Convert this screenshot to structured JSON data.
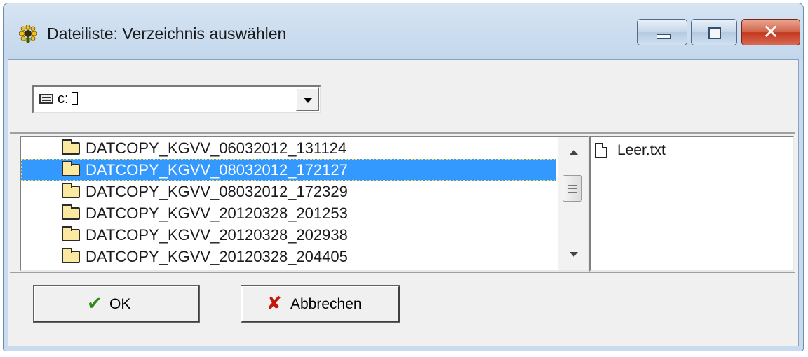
{
  "window": {
    "title": "Dateiliste: Verzeichnis auswählen",
    "icon": "sunflower-app-icon",
    "controls": {
      "minimize": "minimize-icon",
      "maximize": "maximize-icon",
      "close": "close-icon"
    }
  },
  "drive_select": {
    "value": "c:",
    "icon": "drive-icon"
  },
  "directories": [
    {
      "name": "DATCOPY_KGVV_06032012_131124",
      "selected": false
    },
    {
      "name": "DATCOPY_KGVV_08032012_172127",
      "selected": true
    },
    {
      "name": "DATCOPY_KGVV_08032012_172329",
      "selected": false
    },
    {
      "name": "DATCOPY_KGVV_20120328_201253",
      "selected": false
    },
    {
      "name": "DATCOPY_KGVV_20120328_202938",
      "selected": false
    },
    {
      "name": "DATCOPY_KGVV_20120328_204405",
      "selected": false
    }
  ],
  "files": [
    {
      "name": "Leer.txt"
    }
  ],
  "buttons": {
    "ok_label": "OK",
    "cancel_label": "Abbrechen"
  },
  "colors": {
    "selection": "#3399ff",
    "ok_icon": "#2f8a1c",
    "cancel_icon": "#c3190c"
  }
}
